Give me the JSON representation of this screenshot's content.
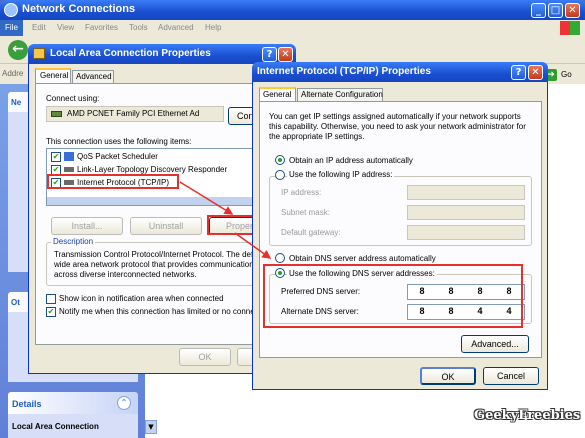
{
  "main_window": {
    "title": "Network Connections",
    "menu": [
      "File",
      "Edit",
      "View",
      "Favorites",
      "Tools",
      "Advanced",
      "Help"
    ],
    "address_label": "Addre",
    "go_label": "Go",
    "sidebar_net_header": "Ne",
    "sidebar_ot_header": "Ot",
    "details_header": "Details",
    "details_item": "Local Area Connection"
  },
  "lac_dialog": {
    "title": "Local Area Connection Properties",
    "help_glyph": "?",
    "tabs": [
      "General",
      "Advanced"
    ],
    "connect_using_label": "Connect using:",
    "adapter_name": "AMD PCNET Family PCI Ethernet Ad",
    "configure_label": "Configu",
    "items_label": "This connection uses the following items:",
    "items": [
      "QoS Packet Scheduler",
      "Link-Layer Topology Discovery Responder",
      "Internet Protocol (TCP/IP)"
    ],
    "install_label": "Install...",
    "uninstall_label": "Uninstall",
    "properties_label": "Properti",
    "description_label": "Description",
    "description_lines": [
      "Transmission Control Protocol/Internet Protocol. The defa",
      "wide area network protocol that provides communication",
      "across diverse interconnected networks."
    ],
    "show_icon_label": "Show icon in notification area when connected",
    "notify_label": "Notify me when this connection has limited or no connec",
    "ok_label": "OK"
  },
  "tcp_dialog": {
    "title": "Internet Protocol (TCP/IP) Properties",
    "help_glyph": "?",
    "tabs": [
      "General",
      "Alternate Configuration"
    ],
    "intro_lines": [
      "You can get IP settings assigned automatically if your network supports",
      "this capability. Otherwise, you need to ask your network administrator for",
      "the appropriate IP settings."
    ],
    "obtain_ip_auto": "Obtain an IP address automatically",
    "use_following_ip": "Use the following IP address:",
    "ip_address_label": "IP address:",
    "subnet_mask_label": "Subnet mask:",
    "gateway_label": "Default gateway:",
    "obtain_dns_auto": "Obtain DNS server address automatically",
    "use_following_dns": "Use the following DNS server addresses:",
    "preferred_dns_label": "Preferred DNS server:",
    "preferred_dns": [
      "8",
      "8",
      "8",
      "8"
    ],
    "alternate_dns_label": "Alternate DNS server:",
    "alternate_dns": [
      "8",
      "8",
      "4",
      "4"
    ],
    "advanced_label": "Advanced...",
    "ok_label": "OK",
    "cancel_label": "Cancel"
  },
  "watermark": "GeekyFreebies",
  "colors": {
    "title_blue": "#245edb",
    "highlight_red": "#e8302a",
    "dialog_bg": "#ece9d8"
  }
}
